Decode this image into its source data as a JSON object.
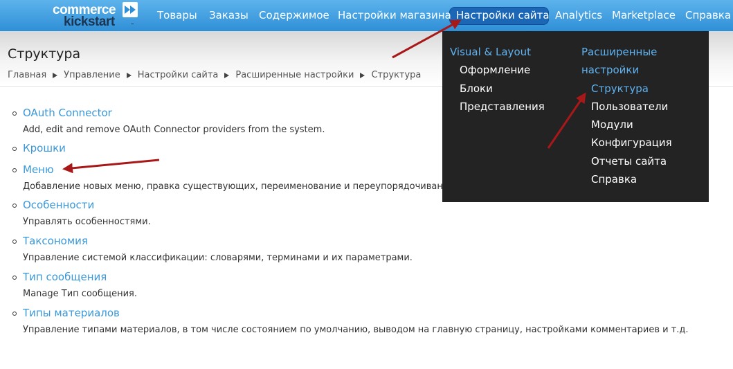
{
  "logo": {
    "top": "commerce",
    "bottom": "kickstart",
    "tm": "™"
  },
  "nav": {
    "items": [
      "Товары",
      "Заказы",
      "Содержимое",
      "Настройки магазина",
      "Настройки сайта",
      "Analytics",
      "Marketplace",
      "Справка"
    ],
    "active": "Настройки сайта"
  },
  "header": {
    "title": "Структура",
    "breadcrumb": [
      "Главная",
      "Управление",
      "Настройки сайта",
      "Расширенные настройки",
      "Структура"
    ]
  },
  "items": [
    {
      "title": "OAuth Connector",
      "desc": "Add, edit and remove OAuth Connector providers from the system."
    },
    {
      "title": "Крошки",
      "desc": ""
    },
    {
      "title": "Меню",
      "desc": "Добавление новых меню, правка существующих, переименование и переупорядочивание ссылок меню."
    },
    {
      "title": "Особенности",
      "desc": "Управлять особенностями."
    },
    {
      "title": "Таксономия",
      "desc": "Управление системой классификации: словарями, терминами и их параметрами."
    },
    {
      "title": "Тип сообщения",
      "desc": "Manage Тип сообщения."
    },
    {
      "title": "Типы материалов",
      "desc": "Управление типами материалов, в том числе состоянием по умолчанию, выводом на главную страницу, настройками комментариев и т.д."
    }
  ],
  "dropdown": {
    "col1": {
      "heading": "Visual & Layout",
      "links": [
        "Оформление",
        "Блоки",
        "Представления"
      ]
    },
    "col2": {
      "heading_line1": "Расширенные",
      "heading_line2": "настройки",
      "links": [
        "Структура",
        "Пользователи",
        "Модули",
        "Конфигурация",
        "Отчеты сайта",
        "Справка"
      ],
      "active": "Структура"
    }
  },
  "colors": {
    "link": "#3a97d8",
    "nav_gradient_top": "#5db3ec",
    "nav_active": "#1b67b5",
    "dropdown_bg": "#232323",
    "dropdown_accent": "#5fb2f0",
    "annotation_arrow": "#a81818"
  },
  "icons": {
    "logo_badge": "fast-forward-icon",
    "breadcrumb_separator": "triangle-right-icon",
    "list_bullet": "circle-bullet-icon",
    "annotations": "arrow-annotation-icon"
  }
}
